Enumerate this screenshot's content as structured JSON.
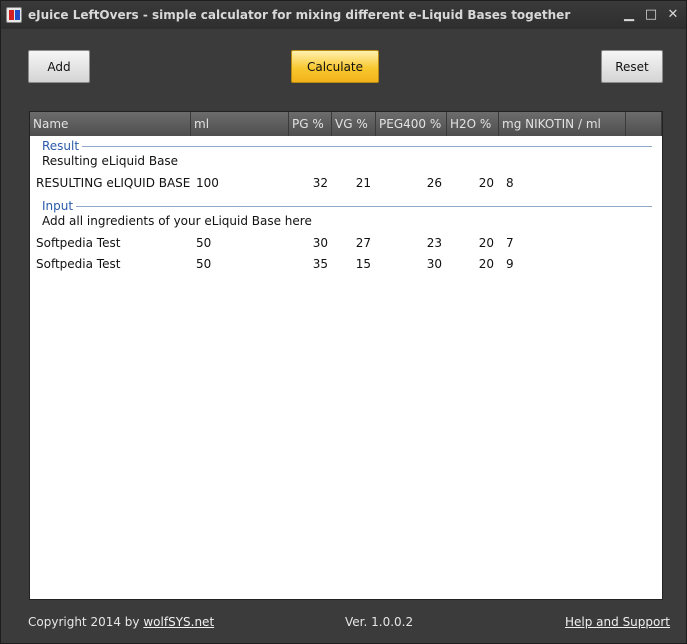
{
  "window": {
    "title": "eJuice LeftOvers - simple calculator for mixing different e-Liquid Bases together",
    "minimize_glyph": "▁",
    "maximize_glyph": "□",
    "close_glyph": "✕"
  },
  "toolbar": {
    "add_label": "Add",
    "calculate_label": "Calculate",
    "reset_label": "Reset"
  },
  "table": {
    "columns": [
      "Name",
      "ml",
      "PG %",
      "VG %",
      "PEG400 %",
      "H2O %",
      "mg NIKOTIN / ml"
    ],
    "groups": [
      {
        "label": "Result",
        "description": "Resulting eLiquid Base",
        "rows": [
          [
            "RESULTING eLIQUID BASE",
            "100",
            "32",
            "21",
            "26",
            "20",
            "8"
          ]
        ]
      },
      {
        "label": "Input",
        "description": "Add all ingredients of your eLiquid Base here",
        "rows": [
          [
            "Softpedia Test",
            "50",
            "30",
            "27",
            "23",
            "20",
            "7"
          ],
          [
            "Softpedia Test",
            "50",
            "35",
            "15",
            "30",
            "20",
            "9"
          ]
        ]
      }
    ]
  },
  "footer": {
    "copyright_prefix": "Copyright 2014 by",
    "copyright_link": "wolfSYS.net",
    "version": "Ver. 1.0.0.2",
    "help_link": "Help and Support"
  },
  "colors": {
    "accent": "#f8c830",
    "group_label": "#2a5aa8"
  }
}
